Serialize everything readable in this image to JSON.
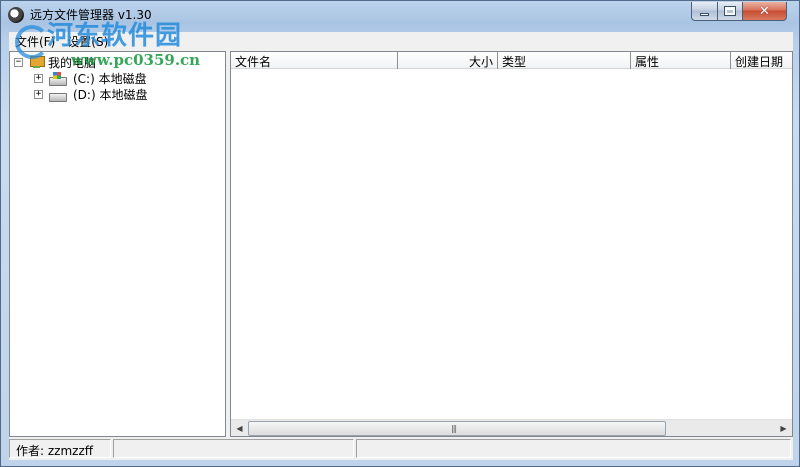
{
  "window": {
    "title": "远方文件管理器 v1.30",
    "close_glyph": "✕"
  },
  "watermark": {
    "name": "河东软件园",
    "url": "www.pc0359.cn"
  },
  "menu": {
    "items": [
      {
        "label": "文件(F)"
      },
      {
        "label": "设置(S)"
      }
    ]
  },
  "tree": {
    "root": {
      "label": "我的电脑",
      "expander": "⊟",
      "icon": "computer-icon"
    },
    "children": [
      {
        "label": "(C:) 本地磁盘",
        "expander": "⊞",
        "icon": "windows-drive-icon"
      },
      {
        "label": "(D:) 本地磁盘",
        "expander": "⊞",
        "icon": "drive-icon"
      }
    ]
  },
  "list": {
    "columns": [
      {
        "label": "文件名"
      },
      {
        "label": "大小"
      },
      {
        "label": "类型"
      },
      {
        "label": "属性"
      },
      {
        "label": "创建日期"
      }
    ],
    "rows": []
  },
  "statusbar": {
    "panels": [
      {
        "text": "作者: zzmzzff"
      },
      {
        "text": ""
      },
      {
        "text": ""
      }
    ]
  }
}
